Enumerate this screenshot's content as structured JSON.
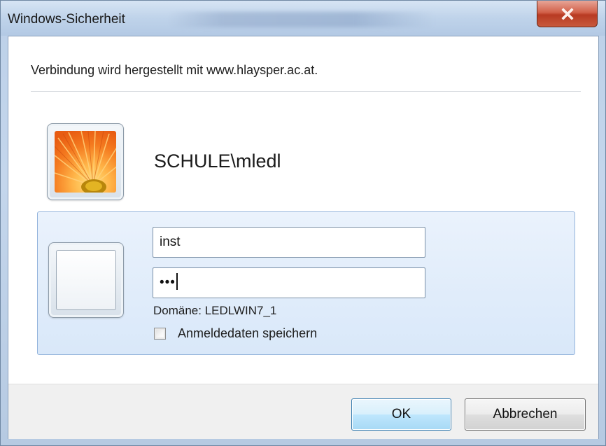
{
  "window": {
    "title": "Windows-Sicherheit"
  },
  "dialog": {
    "connecting_text": "Verbindung wird hergestellt mit www.hlaysper.ac.at.",
    "saved_user": "SCHULE\\mledl"
  },
  "credentials": {
    "username_value": "inst",
    "password_mask": "•••",
    "domain_text": "Domäne: LEDLWIN7_1",
    "remember_label": "Anmeldedaten speichern",
    "remember_checked": false
  },
  "buttons": {
    "ok_label": "OK",
    "cancel_label": "Abbrechen"
  },
  "icons": {
    "close": "close-icon",
    "user_tile": "flower-user-picture",
    "blank_tile": "blank-user-tile"
  },
  "colors": {
    "close_button": "#c8462c",
    "panel_background": "#dfebfa",
    "ok_button": "#bee6fd"
  }
}
